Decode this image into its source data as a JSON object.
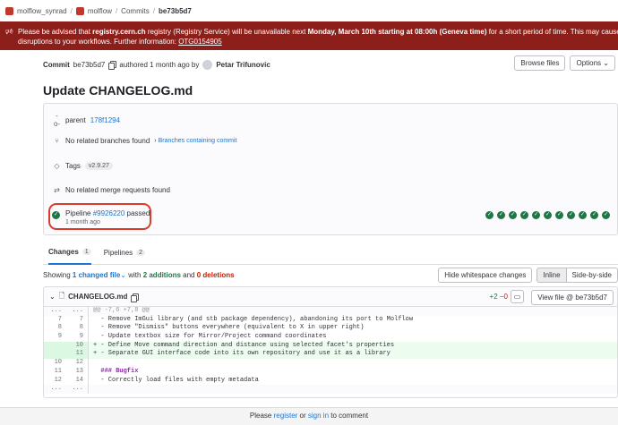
{
  "breadcrumb": {
    "items": [
      "molflow_synrad",
      "molflow",
      "Commits",
      "be73b5d7"
    ],
    "separator": "/"
  },
  "banner": {
    "icon": "megaphone-icon",
    "pre": "Please be advised that ",
    "host": "registry.cern.ch",
    "mid": " registry (Registry Service) will be unavailable next ",
    "when": "Monday, March 10th starting at 08:00h (Geneva time)",
    "post": " for a short period of time. This may cause temporary disruptions to your workflows. Further information: ",
    "ticket": "OTG0154905",
    "color": "#8d1f1a"
  },
  "commit": {
    "label": "Commit",
    "sha": "be73b5d7",
    "authored": "authored 1 month ago by",
    "author": "Petar Trifunovic",
    "browse_files": "Browse files",
    "options": "Options",
    "title": "Update CHANGELOG.md"
  },
  "info": {
    "parent_label": "parent",
    "parent_sha": "178f1294",
    "branches_text": "No related branches found",
    "branches_link": "Branches containing commit",
    "tags_label": "Tags",
    "tag": "v2.9.27",
    "merge_text": "No related merge requests found",
    "pipeline_label": "Pipeline",
    "pipeline_id": "#9926220",
    "pipeline_status": "passed",
    "pipeline_time": "1 month ago",
    "stage_count": 11
  },
  "tabs": [
    {
      "label": "Changes",
      "count": "1"
    },
    {
      "label": "Pipelines",
      "count": "2"
    }
  ],
  "summary": {
    "showing": "Showing",
    "changed": "1 changed file",
    "with": "with",
    "additions": "2 additions",
    "and": "and",
    "deletions": "0 deletions",
    "hide_ws": "Hide whitespace changes",
    "inline": "Inline",
    "side": "Side-by-side"
  },
  "file": {
    "name": "CHANGELOG.md",
    "added": "+2",
    "removed": "−0",
    "view_file": "View file @ be73b5d7",
    "lines": [
      {
        "type": "hunk",
        "old": "...",
        "new": "...",
        "code": "@@ -7,6 +7,8 @@"
      },
      {
        "type": "ctx",
        "old": "7",
        "new": "7",
        "code": "  - Remove ImGui library (and stb package dependency), abandoning its port to Molflow"
      },
      {
        "type": "ctx",
        "old": "8",
        "new": "8",
        "code": "  - Remove \"Dismiss\" buttons everywhere (equivalent to X in upper right)"
      },
      {
        "type": "ctx",
        "old": "9",
        "new": "9",
        "code": "  - Update textbox size for Mirror/Project command coordinates"
      },
      {
        "type": "add",
        "old": "",
        "new": "10",
        "code": "+ - Define Move command direction and distance using selected facet's properties"
      },
      {
        "type": "add",
        "old": "",
        "new": "11",
        "code": "+ - Separate GUI interface code into its own repository and use it as a library"
      },
      {
        "type": "ctx",
        "old": "10",
        "new": "12",
        "code": ""
      },
      {
        "type": "head",
        "old": "11",
        "new": "13",
        "code": "  ### Bugfix"
      },
      {
        "type": "ctx",
        "old": "12",
        "new": "14",
        "code": "  - Correctly load files with empty metadata"
      },
      {
        "type": "hunk",
        "old": "...",
        "new": "...",
        "code": ""
      }
    ]
  },
  "footer": {
    "pre": "Please",
    "register": "register",
    "or": "or",
    "signin": "sign in",
    "post": "to comment"
  }
}
